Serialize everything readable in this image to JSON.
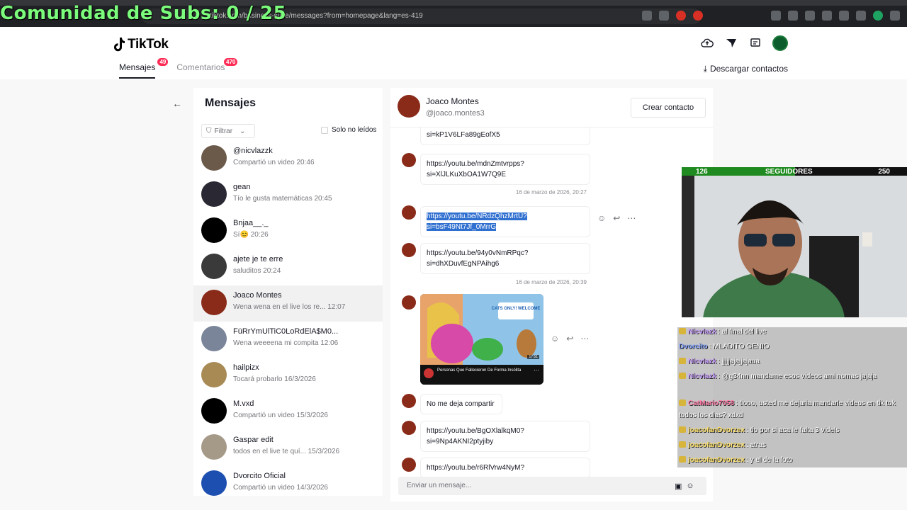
{
  "overlay_title": "Comunidad de Subs: 0 / 25",
  "browser": {
    "url": "tiktok.com/business-suite/messages?from=homepage&lang=es-419"
  },
  "app": {
    "brand": "TikTok",
    "tabs": [
      {
        "label": "Mensajes",
        "badge": "49"
      },
      {
        "label": "Comentarios",
        "badge": "470"
      }
    ],
    "download_label": "Descargar contactos"
  },
  "list": {
    "title": "Mensajes",
    "filter_label": "Filtrar",
    "unread_label": "Solo no leídos",
    "conversations": [
      {
        "name": "@nicvlazzk",
        "preview": "Compartió un video",
        "time": "20:46",
        "color": "#6b5a4a"
      },
      {
        "name": "gean",
        "preview": "Tío le gusta matemáticas",
        "time": "20:45",
        "color": "#2a2833"
      },
      {
        "name": "Bnjaa__._",
        "preview": "Sí😊",
        "time": "20:26",
        "color": "#000000"
      },
      {
        "name": "ajete je te erre",
        "preview": "saluditos",
        "time": "20:24",
        "color": "#3a3a3a"
      },
      {
        "name": "Joaco Montes",
        "preview": "Wena wena en el live los re...",
        "time": "12:07",
        "color": "#8a2b1a"
      },
      {
        "name": "FüRrYmUlTiC0LoRdElA$M0...",
        "preview": "Wena weeeena mi compita",
        "time": "12:06",
        "color": "#7a8599"
      },
      {
        "name": "hailpizx",
        "preview": "Tocará probarlo",
        "time": "16/3/2026",
        "color": "#a88a55"
      },
      {
        "name": "M.vxd",
        "preview": "Compartió un video",
        "time": "15/3/2026",
        "color": "#000000"
      },
      {
        "name": "Gaspar edit",
        "preview": "todos en el live te quí...",
        "time": "15/3/2026",
        "color": "#a59a88"
      },
      {
        "name": "Dvorcito Oficial",
        "preview": "Compartió un video",
        "time": "14/3/2026",
        "color": "#1d4fb0"
      }
    ]
  },
  "chat": {
    "name": "Joaco Montes",
    "handle": "@joaco.montes3",
    "create_contact": "Crear contacto",
    "messages": [
      {
        "line1": "si=kP1V6LFa89gEofX5",
        "line2": ""
      },
      {
        "line1": "https://youtu.be/mdnZmtvrpps?",
        "line2": "si=XlJLKuXbOA1W7Q9E"
      },
      {
        "line1": "https://youtu.be/NRdzQhzMrtU?",
        "line2": "si=bsF49Nt7Jf_0MrrG"
      },
      {
        "line1": "https://youtu.be/94y0vNmRPqc?",
        "line2": "si=dhXDuvfEgNPAihg6"
      },
      {
        "line1": "No me deja compartir",
        "line2": ""
      },
      {
        "line1": "https://youtu.be/BgOXlalkqM0?",
        "line2": "si=9Np4AKNI2ptyjiby"
      },
      {
        "line1": "https://youtu.be/r6RlVrw4NyM?",
        "line2": ""
      }
    ],
    "timestamps": [
      "16 de marzo de 2026, 20:27",
      "16 de marzo de 2026, 20:39"
    ],
    "video": {
      "title": "Personas Que Fallecieron De Forma Insólita",
      "duration": "17:51",
      "sign_text": "CATS ONLY! WELCOME"
    },
    "input_placeholder": "Enviar un mensaje..."
  },
  "stream": {
    "follow_current": "126",
    "follow_label": "SEGUIDORES",
    "follow_goal": "250",
    "follow_progress": 0.504,
    "chat": [
      {
        "user": "Nicvlazk",
        "text": ": al final del live",
        "color": "#c79cff",
        "badge": true
      },
      {
        "user": "Dvorcito",
        "text": ": MLADITO GENIO",
        "color": "#7ea0ff",
        "badge": false
      },
      {
        "user": "Nicvlazk",
        "text": ": jjjjjajajjajaua",
        "color": "#c79cff",
        "badge": true
      },
      {
        "user": "Nicvlazk",
        "text": ": @g34nn mandame esos videos ami nomas jajaja",
        "color": "#c79cff",
        "badge": true
      },
      {
        "user": "CatMario7058",
        "text": ": tiooo, usted me dejaria mandarle videos en tik tok todos los dias? xdxd",
        "color": "#ff7aa8",
        "badge": true
      },
      {
        "user": "joacofanDvorzex",
        "text": ": tio por si aca le falta 3 videls",
        "color": "#ffe26a",
        "badge": true
      },
      {
        "user": "joacofanDvorzex",
        "text": ": atras",
        "color": "#ffe26a",
        "badge": true
      },
      {
        "user": "joacofanDvorzex",
        "text": ": y el de la foto",
        "color": "#ffe26a",
        "badge": true
      }
    ]
  }
}
